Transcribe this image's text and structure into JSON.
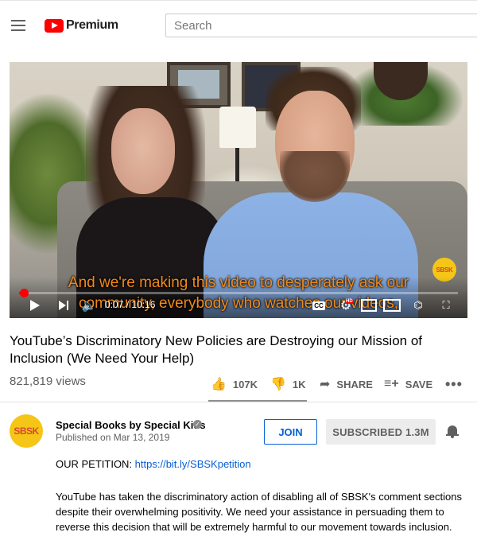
{
  "header": {
    "brand": "Premium",
    "search_placeholder": "Search"
  },
  "player": {
    "captions": [
      "And we're making this video to desperately ask our",
      "community, everybody who watches our videos,"
    ],
    "time_current": "0:07",
    "time_total": "10:16",
    "time_display": "0:07 / 10:16",
    "progress_fraction": 0.011,
    "watermark": "SBSK",
    "cc_label": "CC",
    "hd_badge": "HD",
    "play_icon": "play-icon",
    "next_icon": "next-icon",
    "volume_icon": "volume-icon",
    "settings_icon": "gear-icon",
    "miniplayer_icon": "miniplayer-icon",
    "theater_icon": "theater-icon",
    "cast_icon": "cast-icon",
    "fullscreen_icon": "fullscreen-icon"
  },
  "video": {
    "title": "YouTube’s Discriminatory New Policies are Destroying our Mission of Inclusion (We Need Your Help)",
    "views": "821,819 views"
  },
  "actions": {
    "likes": "107K",
    "dislikes": "1K",
    "share": "SHARE",
    "save": "SAVE",
    "more": "•••"
  },
  "channel": {
    "avatar_text": "SBSK",
    "name": "Special Books by Special Kids",
    "verified_mark": "✓",
    "published": "Published on Mar 13, 2019",
    "join_label": "JOIN",
    "subscribe_label": "SUBSCRIBED  1.3M"
  },
  "description": {
    "petition_label": "OUR PETITION: ",
    "petition_link": "https://bit.ly/SBSKpetition",
    "body": "YouTube has taken the discriminatory action of disabling all of SBSK's comment sections despite their overwhelming positivity. We need your assistance in persuading them to reverse this decision that will be extremely harmful to our movement towards inclusion."
  },
  "colors": {
    "brand_red": "#ff0000",
    "link_blue": "#065fd4",
    "caption_orange": "#f08a1a",
    "avatar_yellow": "#f5c518"
  }
}
